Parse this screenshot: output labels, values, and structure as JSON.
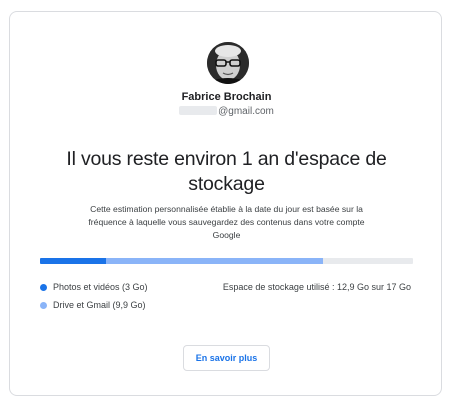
{
  "profile": {
    "name": "Fabrice Brochain",
    "email_suffix": "@gmail.com"
  },
  "headline": "Il vous reste environ 1 an d'espace de stockage",
  "description": "Cette estimation personnalisée établie à la date du jour est basée sur la fréquence à laquelle vous sauvegardez des contenus dans votre compte Google",
  "storage": {
    "usage_label": "Espace de stockage utilisé : 12,9 Go sur 17 Go",
    "used_fraction": 0.759,
    "segments": [
      {
        "label": "Photos et vidéos (3 Go)",
        "fraction": 0.176,
        "color": "#1a73e8"
      },
      {
        "label": "Drive et Gmail (9,9 Go)",
        "fraction": 0.582,
        "color": "#8ab4f8"
      }
    ],
    "track_color": "#e8eaed"
  },
  "cta": {
    "label": "En savoir plus",
    "color": "#1a73e8"
  }
}
